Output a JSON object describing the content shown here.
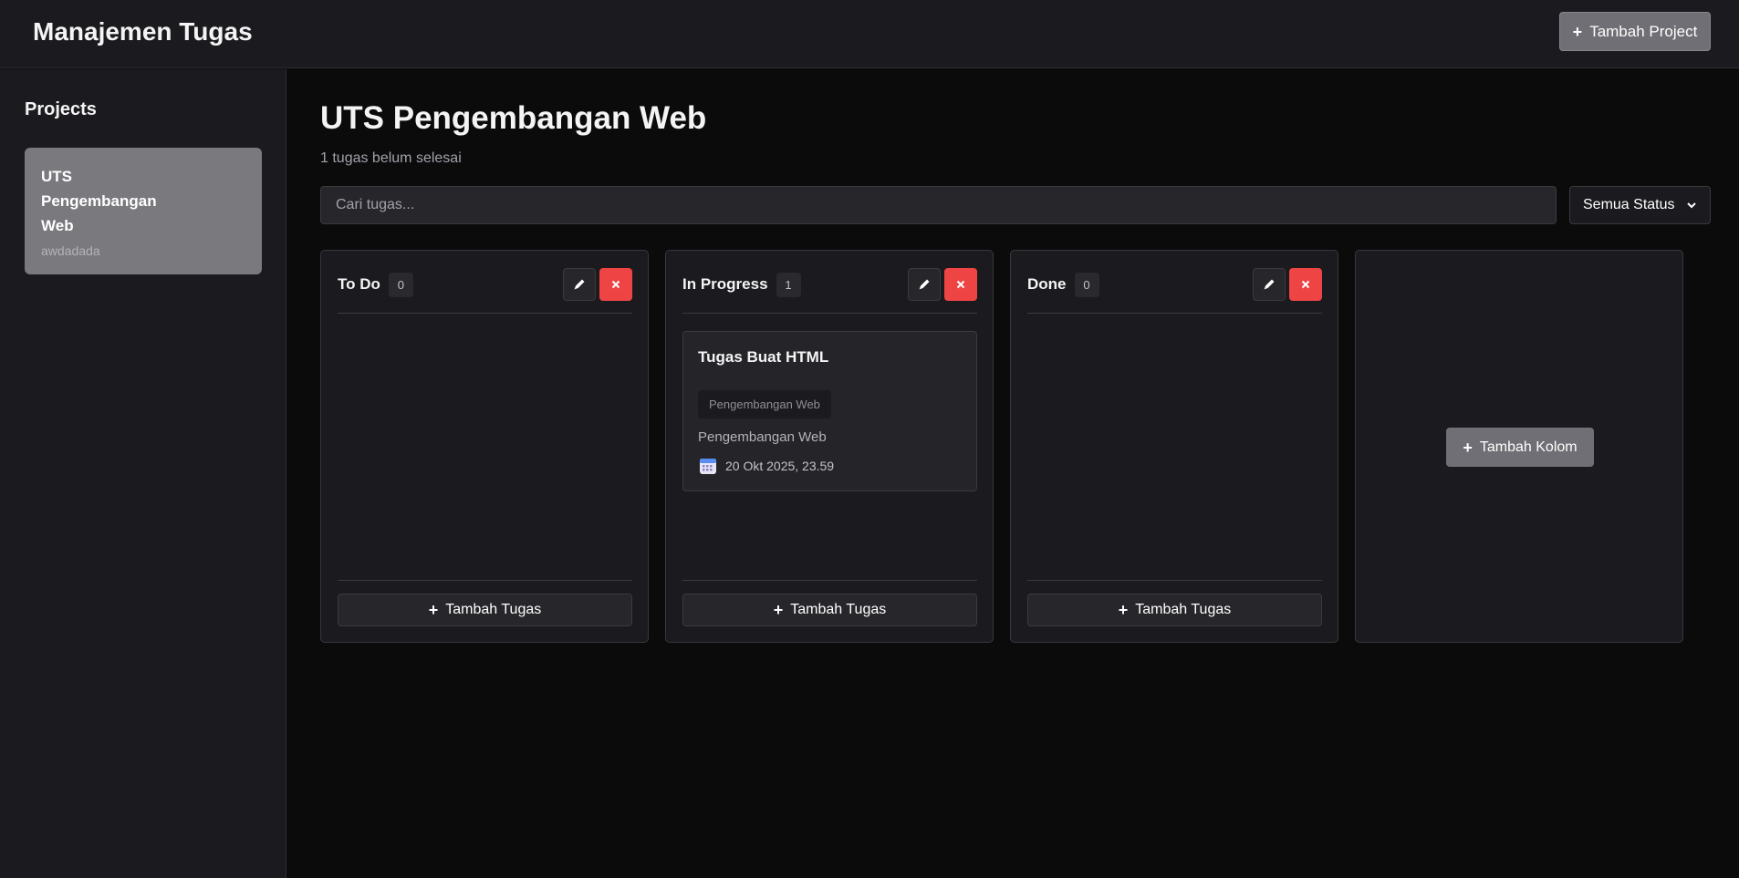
{
  "app": {
    "title": "Manajemen Tugas",
    "add_project_label": "Tambah Project"
  },
  "sidebar": {
    "heading": "Projects",
    "projects": [
      {
        "name": "UTS Pengembangan Web",
        "description": "awdadada",
        "active": true
      }
    ]
  },
  "main": {
    "title": "UTS Pengembangan Web",
    "subtitle": "1 tugas belum selesai",
    "search": {
      "placeholder": "Cari tugas...",
      "value": ""
    },
    "status_filter": {
      "selected": "Semua Status"
    },
    "columns": [
      {
        "title": "To Do",
        "count": "0",
        "add_label": "Tambah Tugas",
        "tasks": []
      },
      {
        "title": "In Progress",
        "count": "1",
        "add_label": "Tambah Tugas",
        "tasks": [
          {
            "title": "Tugas Buat HTML",
            "tag": "Pengembangan Web",
            "project": "Pengembangan Web",
            "due": "20 Okt 2025, 23.59"
          }
        ]
      },
      {
        "title": "Done",
        "count": "0",
        "add_label": "Tambah Tugas",
        "tasks": []
      }
    ],
    "add_column_label": "Tambah Kolom"
  },
  "colors": {
    "background": "#0b0b0c",
    "surface": "#1b1b1f",
    "accent_gray": "#6f6f75",
    "danger": "#ef4444"
  },
  "icons": {
    "edit": "pencil-icon",
    "delete": "close-icon",
    "add": "plus-icon",
    "due": "calendar-icon",
    "dropdown": "chevron-down-icon"
  }
}
